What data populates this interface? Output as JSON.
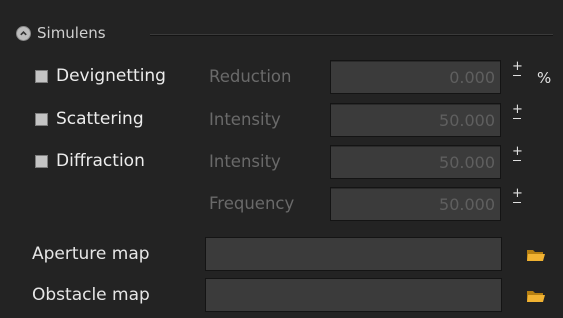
{
  "section": {
    "title": "Simulens"
  },
  "effects": [
    {
      "enabled_label": "Devignetting",
      "param_label": "Reduction",
      "value": "0.000",
      "unit": "%"
    },
    {
      "enabled_label": "Scattering",
      "param_label": "Intensity",
      "value": "50.000",
      "unit": ""
    },
    {
      "enabled_label": "Diffraction",
      "param_label": "Intensity",
      "value": "50.000",
      "unit": ""
    },
    {
      "enabled_label": "",
      "param_label": "Frequency",
      "value": "50.000",
      "unit": ""
    }
  ],
  "maps": [
    {
      "label": "Aperture map",
      "value": ""
    },
    {
      "label": "Obstacle map",
      "value": ""
    }
  ],
  "icons": {
    "collapse": "collapse-circle-icon",
    "browse": "folder-icon",
    "plus": "plus-icon",
    "minus": "minus-icon"
  },
  "colors": {
    "background": "#232323",
    "field": "#3b3b3b",
    "folder": "#e0a526",
    "label_disabled": "#6a6a6a"
  }
}
